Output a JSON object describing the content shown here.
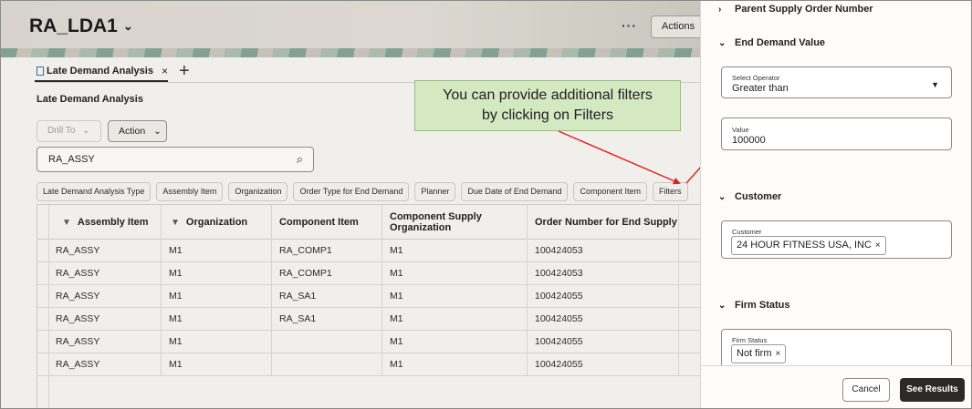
{
  "app": {
    "title": "RA_LDA1",
    "overflow_label": "···",
    "actions_label": "Actions"
  },
  "tab": {
    "label": "Late Demand Analysis",
    "close": "×",
    "add": "+"
  },
  "section_title": "Late Demand Analysis",
  "toolbar": {
    "drill_label": "Drill To",
    "action_label": "Action"
  },
  "search": {
    "value": "RA_ASSY"
  },
  "filter_chips": [
    "Late Demand Analysis Type",
    "Assembly Item",
    "Organization",
    "Order Type for End Demand",
    "Planner",
    "Due Date of End Demand",
    "Component Item",
    "Filters"
  ],
  "table": {
    "headers": [
      "Assembly Item",
      "Organization",
      "Component Item",
      "Component Supply Organization",
      "Order Number for End Supply"
    ],
    "rows": [
      [
        "RA_ASSY",
        "M1",
        "RA_COMP1",
        "M1",
        "100424053"
      ],
      [
        "RA_ASSY",
        "M1",
        "RA_COMP1",
        "M1",
        "100424053"
      ],
      [
        "RA_ASSY",
        "M1",
        "RA_SA1",
        "M1",
        "100424055"
      ],
      [
        "RA_ASSY",
        "M1",
        "RA_SA1",
        "M1",
        "100424055"
      ],
      [
        "RA_ASSY",
        "M1",
        "",
        "M1",
        "100424055"
      ],
      [
        "RA_ASSY",
        "M1",
        "",
        "M1",
        "100424055"
      ]
    ]
  },
  "callout": {
    "line1": "You can provide additional filters",
    "line2": "by clicking on Filters",
    "color": "#d4e8c2",
    "arrow_color": "#e0201b"
  },
  "panel": {
    "parent_supply_order": "Parent Supply Order Number",
    "end_demand_value": "End Demand Value",
    "operator_label": "Select Operator",
    "operator_value": "Greater than",
    "value_label": "Value",
    "value": "100000",
    "customer_section": "Customer",
    "customer_label": "Customer",
    "customer_token": "24 HOUR FITNESS USA, INC",
    "firm_section": "Firm Status",
    "firm_label": "Firm Status",
    "firm_token": "Not firm",
    "cancel_label": "Cancel",
    "results_label": "See Results"
  }
}
